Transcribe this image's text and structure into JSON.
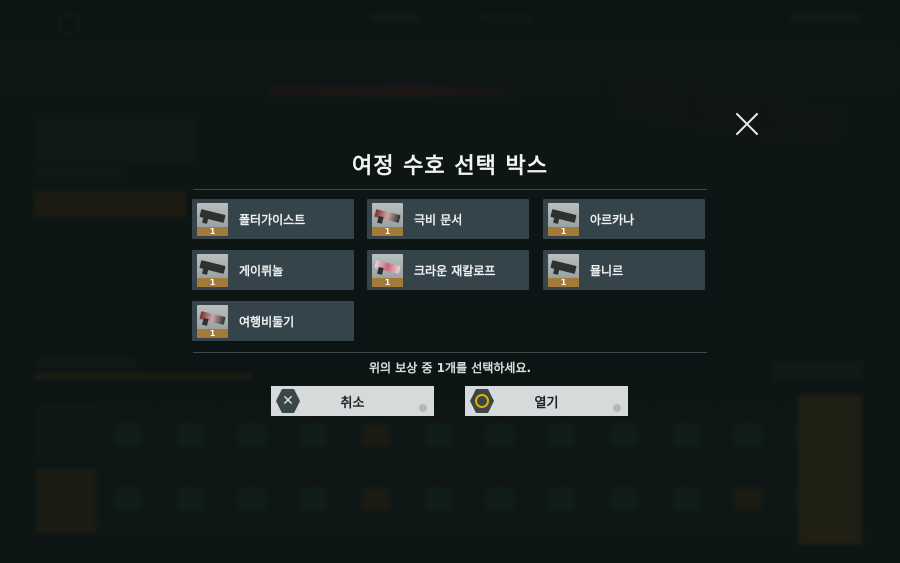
{
  "dialog": {
    "title": "여정 수호 선택 박스",
    "hint": "위의 보상 중 1개를 선택하세요.",
    "items": [
      {
        "name": "폴터가이스트",
        "qty": "1"
      },
      {
        "name": "극비 문서",
        "qty": "1"
      },
      {
        "name": "아르카나",
        "qty": "1"
      },
      {
        "name": "게이뤼놀",
        "qty": "1"
      },
      {
        "name": "크라운 재칼로프",
        "qty": "1"
      },
      {
        "name": "묠니르",
        "qty": "1"
      },
      {
        "name": "여행비둘기",
        "qty": "1"
      }
    ],
    "cancel_label": "취소",
    "open_label": "열기"
  },
  "icons": {
    "close": "close-icon",
    "cancel": "x-button-icon",
    "open": "circle-button-icon"
  },
  "colors": {
    "accent_gold": "#e0b000",
    "item_bg": "#34444a",
    "qty_badge": "#a37a3a",
    "button_bg": "#d7dadb"
  }
}
